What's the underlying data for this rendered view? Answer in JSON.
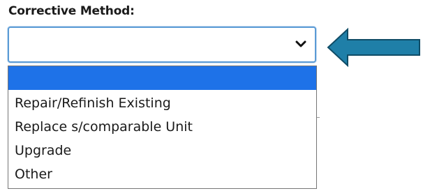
{
  "form": {
    "label": "Corrective Method:",
    "select": {
      "current_value": "",
      "chevron_icon": "chevron-down-icon"
    },
    "options": [
      {
        "label": "",
        "highlighted": true
      },
      {
        "label": "Repair/Refinish Existing",
        "highlighted": false
      },
      {
        "label": "Replace s/comparable Unit",
        "highlighted": false
      },
      {
        "label": "Upgrade",
        "highlighted": false
      },
      {
        "label": "Other",
        "highlighted": false
      }
    ]
  },
  "annotation": {
    "arrow_icon": "left-arrow-icon",
    "arrow_fill": "#1f7fa8",
    "arrow_stroke": "#0f4c66"
  },
  "colors": {
    "highlight": "#1e72e8",
    "focus_border": "#5b9bd5"
  }
}
